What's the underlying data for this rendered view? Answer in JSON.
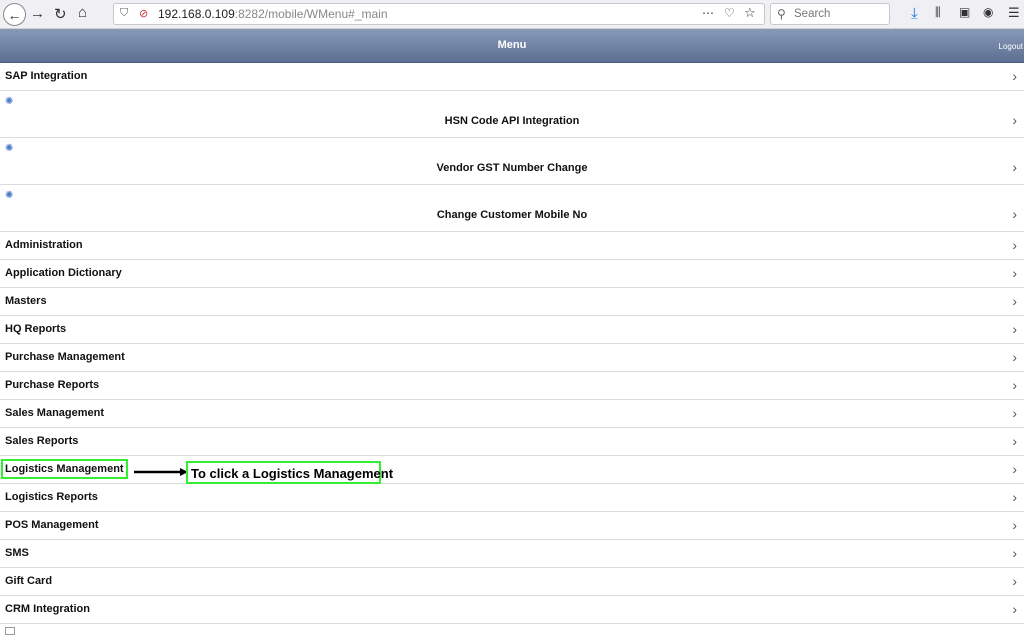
{
  "browser": {
    "url_host": "192.168.0.109",
    "url_rest": ":8282/mobile/WMenu#_main",
    "search_placeholder": "Search",
    "more_icon": "⋯"
  },
  "header": {
    "title": "Menu",
    "logout": "Logout"
  },
  "menu": {
    "items": [
      {
        "label": "SAP Integration",
        "type": "plain"
      },
      {
        "label": "HSN Code API Integration",
        "type": "gear"
      },
      {
        "label": "Vendor GST Number Change",
        "type": "gear"
      },
      {
        "label": "Change Customer Mobile No",
        "type": "gear"
      },
      {
        "label": "Administration",
        "type": "plain"
      },
      {
        "label": "Application Dictionary",
        "type": "plain"
      },
      {
        "label": "Masters",
        "type": "plain"
      },
      {
        "label": "HQ Reports",
        "type": "plain"
      },
      {
        "label": "Purchase Management",
        "type": "plain"
      },
      {
        "label": "Purchase Reports",
        "type": "plain"
      },
      {
        "label": "Sales Management",
        "type": "plain"
      },
      {
        "label": "Sales Reports",
        "type": "plain"
      },
      {
        "label": "Logistics Management",
        "type": "plain"
      },
      {
        "label": "Logistics Reports",
        "type": "plain"
      },
      {
        "label": "POS Management",
        "type": "plain"
      },
      {
        "label": "SMS",
        "type": "plain"
      },
      {
        "label": "Gift Card",
        "type": "plain"
      },
      {
        "label": "CRM Integration",
        "type": "plain"
      }
    ]
  },
  "annotation": {
    "text": "To click a Logistics Management",
    "color": "#33ee33"
  },
  "colors": {
    "header_top": "#8899b8",
    "header_bottom": "#5d6f92",
    "gear": "#4a7bc8"
  }
}
